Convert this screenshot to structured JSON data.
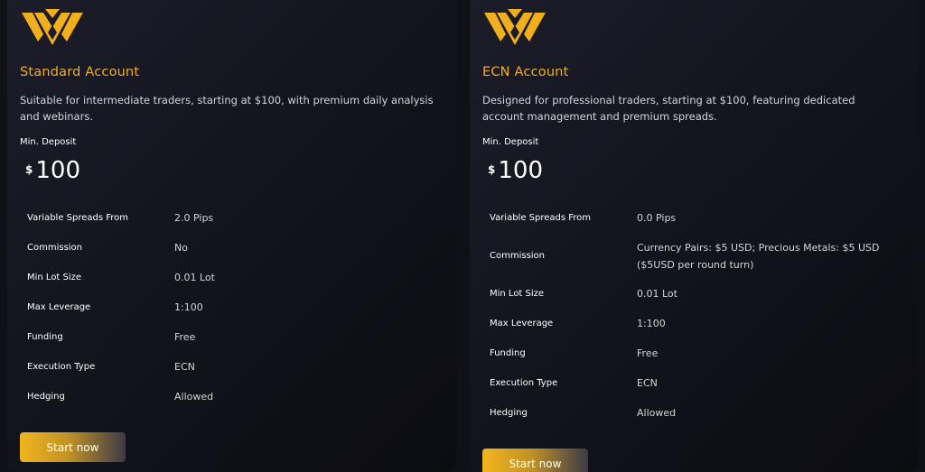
{
  "colors": {
    "accent": "#f0b01e",
    "background": "#101018",
    "card": "#171822"
  },
  "icons": {
    "logo": "winged-w-logo-icon"
  },
  "cards": [
    {
      "title": "Standard Account",
      "description": "Suitable for intermediate traders, starting at $100, with premium daily analysis and webinars.",
      "min_deposit_label": "Min. Deposit",
      "currency": "$",
      "amount": "100",
      "specs": [
        {
          "label": "Variable Spreads From",
          "value": "2.0 Pips"
        },
        {
          "label": "Commission",
          "value": "No"
        },
        {
          "label": "Min Lot Size",
          "value": "0.01 Lot"
        },
        {
          "label": "Max Leverage",
          "value": "1:100"
        },
        {
          "label": "Funding",
          "value": "Free"
        },
        {
          "label": "Execution Type",
          "value": "ECN"
        },
        {
          "label": "Hedging",
          "value": "Allowed"
        }
      ],
      "button": "Start now"
    },
    {
      "title": "ECN Account",
      "description": "Designed for professional traders, starting at $100, featuring dedicated account management and premium spreads.",
      "min_deposit_label": "Min. Deposit",
      "currency": "$",
      "amount": "100",
      "specs": [
        {
          "label": "Variable Spreads From",
          "value": "0.0 Pips"
        },
        {
          "label": "Commission",
          "value": "Currency Pairs: $5 USD; Precious Metals: $5 USD ($5USD per round turn)"
        },
        {
          "label": "Min Lot Size",
          "value": "0.01 Lot"
        },
        {
          "label": "Max Leverage",
          "value": "1:100"
        },
        {
          "label": "Funding",
          "value": "Free"
        },
        {
          "label": "Execution Type",
          "value": "ECN"
        },
        {
          "label": "Hedging",
          "value": "Allowed"
        }
      ],
      "button": "Start now"
    }
  ]
}
